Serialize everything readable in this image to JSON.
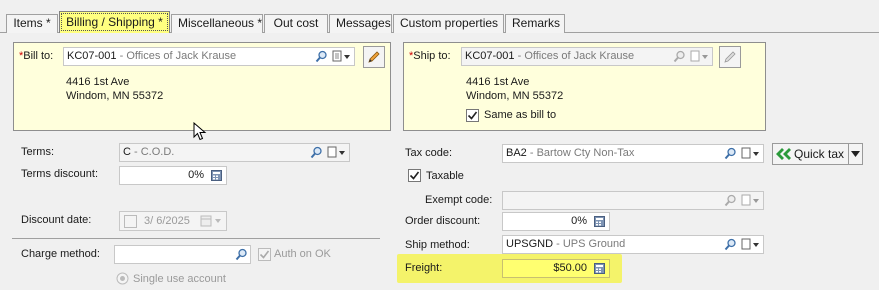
{
  "tabs": [
    {
      "label": "Items *"
    },
    {
      "label": "Billing / Shipping  *"
    },
    {
      "label": "Miscellaneous *"
    },
    {
      "label": "Out cost"
    },
    {
      "label": "Messages"
    },
    {
      "label": "Custom properties"
    },
    {
      "label": "Remarks"
    }
  ],
  "bill_to": {
    "label": "Bill to:",
    "code": "KC07-001",
    "desc": " - Offices of Jack Krause",
    "address_line1": "4416 1st Ave",
    "address_line2": "Windom, MN 55372"
  },
  "ship_to": {
    "label": "Ship to:",
    "code": "KC07-001",
    "desc": " - Offices of Jack Krause",
    "address_line1": "4416 1st Ave",
    "address_line2": "Windom, MN 55372",
    "same_as_bill_label": "Same as bill to",
    "same_as_bill_checked": true
  },
  "left": {
    "terms_label": "Terms:",
    "terms_code": "C",
    "terms_desc": " - C.O.D.",
    "terms_discount_label": "Terms discount:",
    "terms_discount_value": "0%",
    "discount_date_label": "Discount date:",
    "discount_date_value": "3/  6/2025",
    "charge_method_label": "Charge method:",
    "auth_on_ok_label": "Auth on OK",
    "single_use_label": "Single use account"
  },
  "right": {
    "tax_code_label": "Tax code:",
    "tax_code": "BA2",
    "tax_desc": " - Bartow Cty Non-Tax",
    "quick_tax_label": "Quick tax",
    "taxable_label": "Taxable",
    "taxable_checked": true,
    "exempt_code_label": "Exempt code:",
    "order_discount_label": "Order discount:",
    "order_discount_value": "0%",
    "ship_method_label": "Ship method:",
    "ship_method_code": "UPSGND",
    "ship_method_desc": " - UPS Ground",
    "freight_label": "Freight:",
    "freight_value": "$50.00"
  },
  "colors": {
    "panel_bg": "#ffffdc",
    "active_tab": "#ffff80",
    "highlight": "#f4f36a",
    "required": "#d00000"
  }
}
